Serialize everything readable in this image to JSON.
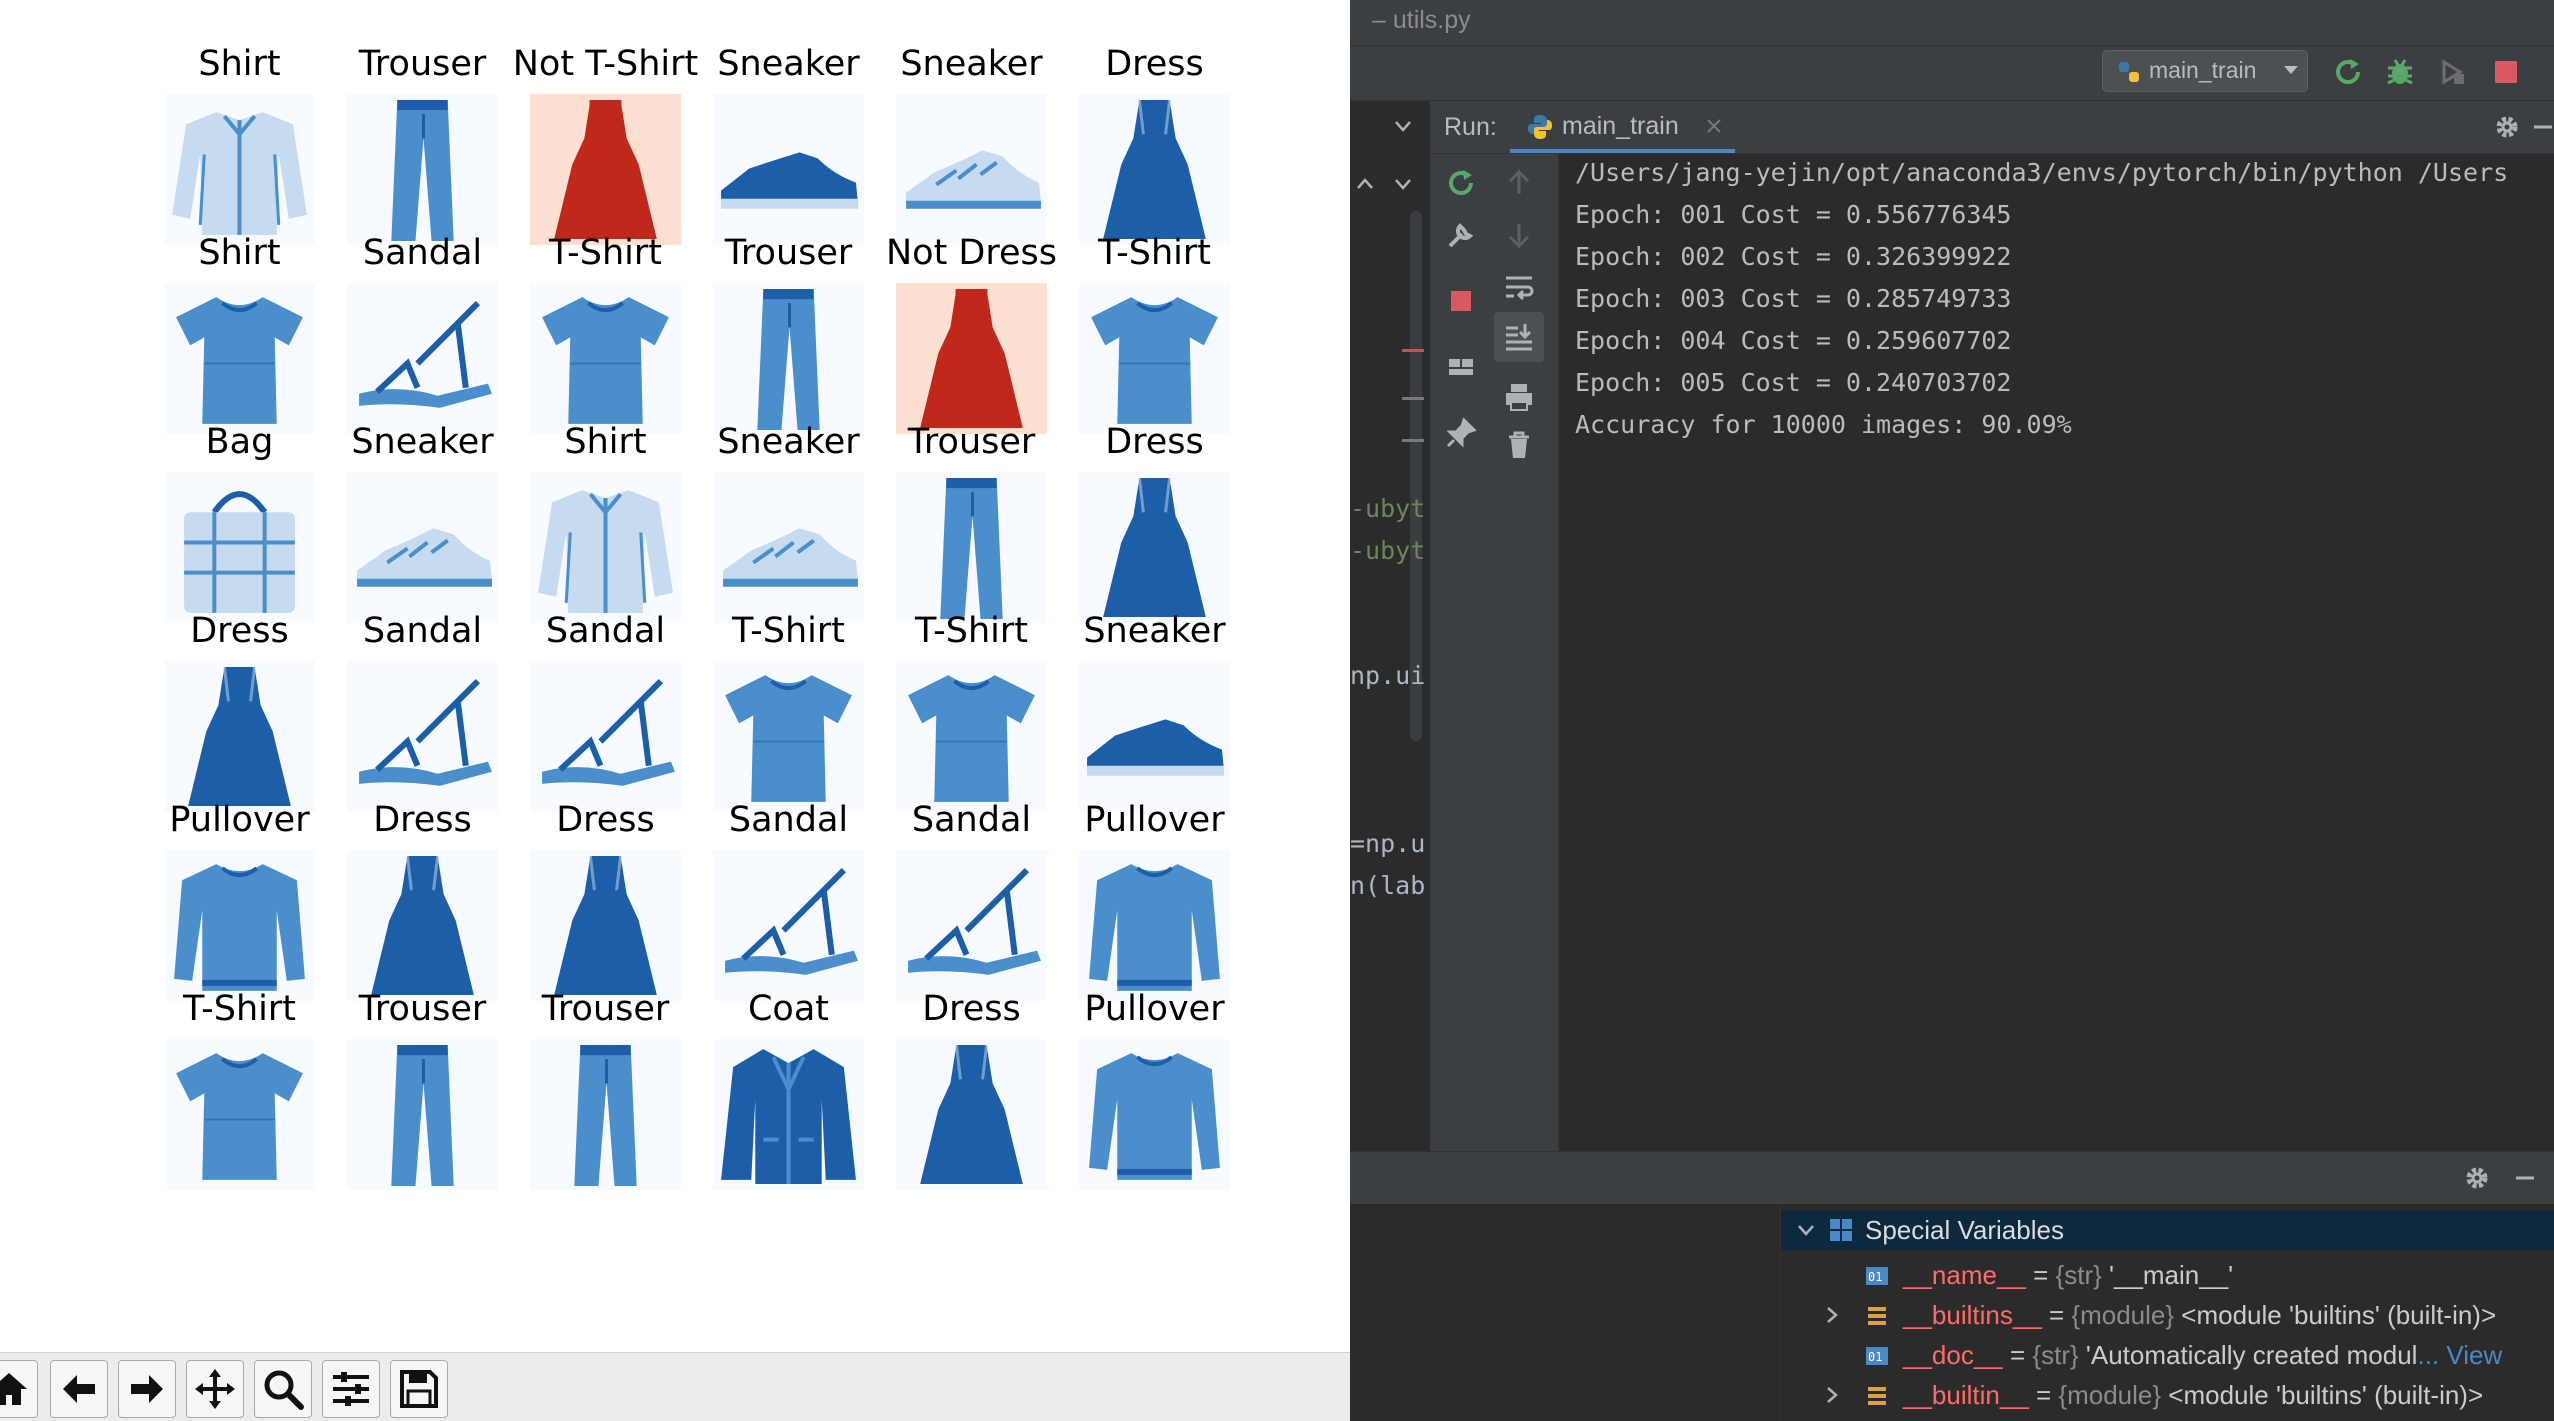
{
  "figure": {
    "labels": [
      [
        "Shirt",
        "Trouser",
        "Not T-Shirt",
        "Sneaker",
        "Sneaker",
        "Dress"
      ],
      [
        "Shirt",
        "Sandal",
        "T-Shirt",
        "Trouser",
        "Not Dress",
        "T-Shirt"
      ],
      [
        "Bag",
        "Sneaker",
        "Shirt",
        "Sneaker",
        "Trouser",
        "Dress"
      ],
      [
        "Dress",
        "Sandal",
        "Sandal",
        "T-Shirt",
        "T-Shirt",
        "Sneaker"
      ],
      [
        "Pullover",
        "Dress",
        "Dress",
        "Sandal",
        "Sandal",
        "Pullover"
      ],
      [
        "T-Shirt",
        "Trouser",
        "Trouser",
        "Coat",
        "Dress",
        "Pullover"
      ]
    ],
    "images": [
      [
        "shirt",
        "trouser",
        "dress",
        "sneaker",
        "sneaker-light",
        "dress"
      ],
      [
        "tshirt",
        "sandal",
        "tshirt",
        "trouser",
        "dress",
        "tshirt"
      ],
      [
        "bag",
        "sneaker-light",
        "shirt",
        "sneaker-light",
        "trouser",
        "dress"
      ],
      [
        "dress",
        "sandal",
        "sandal",
        "tshirt",
        "tshirt",
        "sneaker"
      ],
      [
        "pullover",
        "dress",
        "dress",
        "sandal",
        "sandal",
        "pullover"
      ],
      [
        "tshirt",
        "trouser",
        "trouser",
        "coat",
        "dress",
        "pullover"
      ]
    ],
    "highlight_red": [
      [
        0,
        2
      ],
      [
        1,
        4
      ]
    ],
    "colors": {
      "blue_dark": "#1c5ea8",
      "blue_mid": "#4a8fcb",
      "blue_light": "#c6dbef",
      "background": "#f7fbff",
      "red_dark": "#c0281c",
      "red_light": "#fee0d2"
    }
  },
  "mpl_toolbar": {
    "buttons": [
      "home-icon",
      "back-icon",
      "forward-icon",
      "pan-icon",
      "zoom-icon",
      "configure-icon",
      "save-icon"
    ]
  },
  "ide": {
    "title": "– utils.py",
    "run_config": "main_train",
    "run_label": "Run:",
    "run_tab": "main_train",
    "console_lines": [
      "/Users/jang-yejin/opt/anaconda3/envs/pytorch/bin/python /Users",
      "Epoch: 001 Cost = 0.556776345",
      "Epoch: 002 Cost = 0.326399922",
      "Epoch: 003 Cost = 0.285749733",
      "Epoch: 004 Cost = 0.259607702",
      "Epoch: 005 Cost = 0.240703702",
      "Accuracy for 10000 images: 90.09%"
    ],
    "code_fragments": [
      "-ubyt",
      "-ubyt",
      "np.ui",
      "=np.u",
      "n(lab"
    ],
    "variables": {
      "header": "Special Variables",
      "rows": [
        {
          "name": "__name__",
          "eq": " = ",
          "type": "{str} ",
          "value": "'__main__'",
          "more": ""
        },
        {
          "name": "__builtins__",
          "eq": " = ",
          "type": "{module} ",
          "value": "<module 'builtins' (built-in)>",
          "more": ""
        },
        {
          "name": "__doc__",
          "eq": " = ",
          "type": "{str} ",
          "value": "'Automatically created modul",
          "more": "... View"
        },
        {
          "name": "__builtin__",
          "eq": " = ",
          "type": "{module} ",
          "value": "<module 'builtins' (built-in)>",
          "more": ""
        }
      ]
    }
  }
}
